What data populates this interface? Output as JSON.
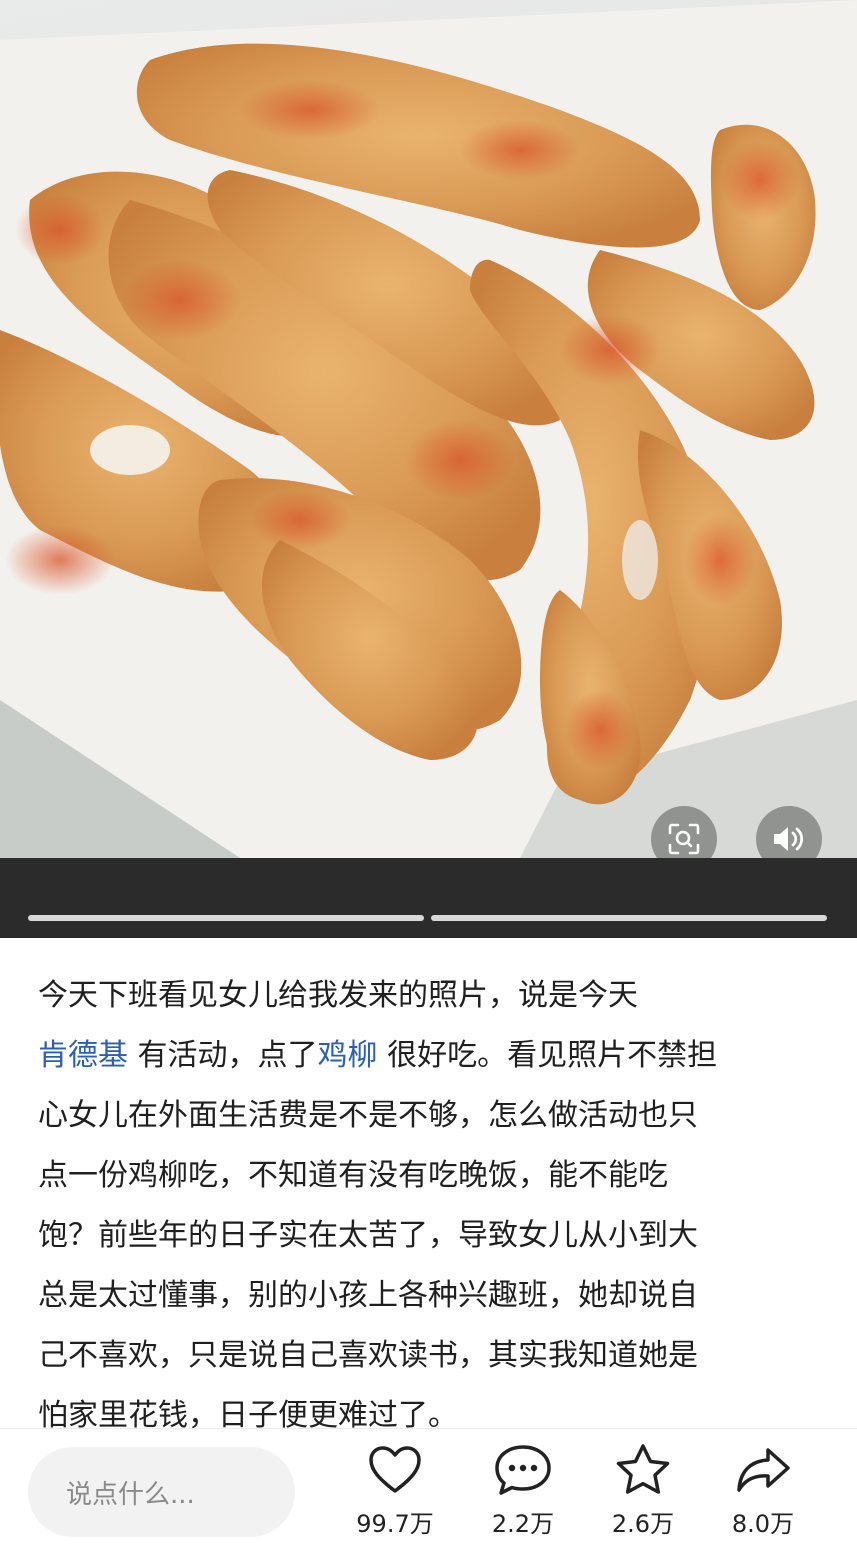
{
  "media": {
    "image_desc": "photo",
    "scan_icon": "lens-scan-icon",
    "sound_icon": "speaker-icon"
  },
  "post": {
    "lines": [
      "今天下班看见女儿给我发来的照片，说是今天",
      "有活动，点了",
      "很好吃。看见照片不禁担",
      "心女儿在外面生活费是不是不够，怎么做活动也只",
      "点一份鸡柳吃，不知道有没有吃晚饭，能不能吃",
      "饱？前些年的日子实在太苦了，导致女儿从小到大",
      "总是太过懂事，别的小孩上各种兴趣班，她却说自",
      "己不喜欢，只是说自己喜欢读书，其实我知道她是",
      "怕家里花钱，日子便更难过了。"
    ],
    "link_1": "肯德基",
    "link_2": "鸡柳",
    "link_color": "#2b5fb3"
  },
  "bottom_bar": {
    "comment_placeholder": "说点什么...",
    "likes": "99.7万",
    "comments": "2.2万",
    "favorites": "2.6万",
    "shares": "8.0万",
    "icons": [
      "heart-icon",
      "comment-bubble-icon",
      "star-icon",
      "share-arrow-icon"
    ]
  }
}
